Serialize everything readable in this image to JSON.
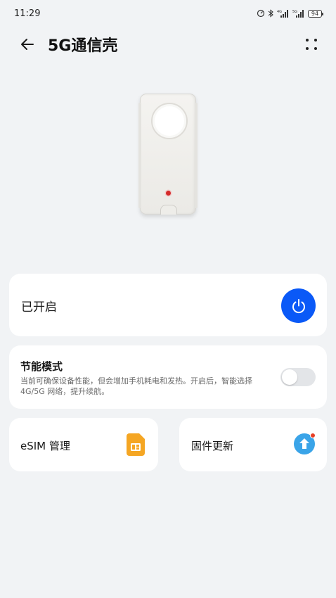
{
  "status_bar": {
    "time": "11:29",
    "battery": "94"
  },
  "header": {
    "title": "5G通信壳"
  },
  "power_card": {
    "label": "已开启",
    "state": "on",
    "accent": "#0a59f7"
  },
  "eco_card": {
    "title": "节能模式",
    "description": "当前可确保设备性能，但会增加手机耗电和发热。开启后，智能选择 4G/5G 网络，提升续航。",
    "enabled": false
  },
  "esim_card": {
    "label": "eSIM 管理",
    "icon": "sim-card-icon",
    "icon_color": "#f5a623"
  },
  "firmware_card": {
    "label": "固件更新",
    "icon": "upload-cloud-icon",
    "icon_color": "#3aa4e8",
    "badge_color": "#e84026"
  }
}
